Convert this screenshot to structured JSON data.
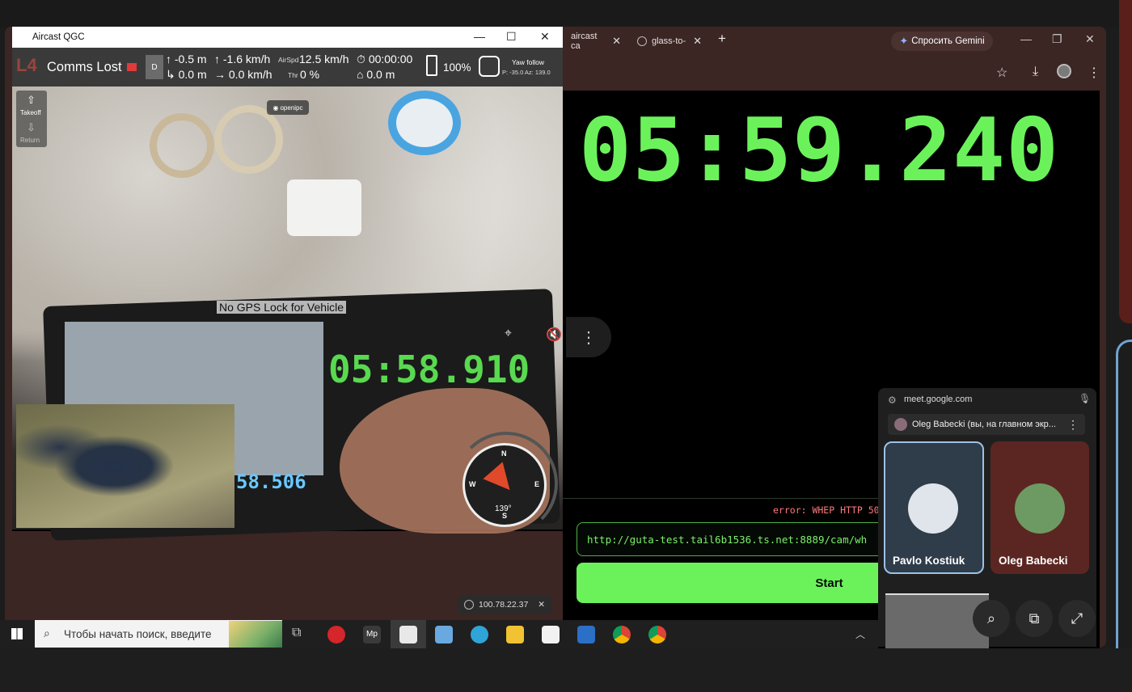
{
  "browser": {
    "tabs": [
      {
        "label": "aircast ca"
      },
      {
        "label": "glass-to-"
      }
    ],
    "gemini_button": "Спросить Gemini",
    "page": {
      "timer": "05:59.240",
      "error_text": "error: WHEP HTTP 50",
      "stream_url": "http://guta-test.tail6b1536.ts.net:8889/cam/wh",
      "start_label": "Start"
    }
  },
  "meet": {
    "url": "meet.google.com",
    "banner": "Oleg Babecki (вы, на главном экр...",
    "participants": [
      {
        "name": "Pavlo Kostiuk"
      },
      {
        "name": "Oleg Babecki"
      }
    ]
  },
  "qgc": {
    "window_title": "Aircast QGC",
    "status": "Comms Lost",
    "mode_label": "D",
    "telemetry": {
      "alt_rel": "-0.5 m",
      "vspeed": "-1.6 km/h",
      "airspeed_label": "AirSpd",
      "airspeed": "12.5 km/h",
      "flight_time": "00:00:00",
      "distance": "0.0 m",
      "ground_speed": "0.0 km/h",
      "throttle_label": "Thr",
      "throttle": "0 %",
      "dist_home": "0.0 m"
    },
    "battery": "100%",
    "yaw_follow": "Yaw follow",
    "gimbal_angles": "P: -35.0 Az: 139.0",
    "takeoff_label": "Takeoff",
    "return_label": "Return",
    "camera_label": "openipc",
    "gps_message": "No GPS Lock for Vehicle",
    "video_timer": "05:58.910",
    "video_sub_reading": "58.506",
    "compass": {
      "n": "N",
      "e": "E",
      "s": "S",
      "w": "W",
      "heading": "139°"
    }
  },
  "taskbar": {
    "search_placeholder": "Чтобы начать поиск, введите",
    "ip_chip": "100.78.22.37"
  }
}
